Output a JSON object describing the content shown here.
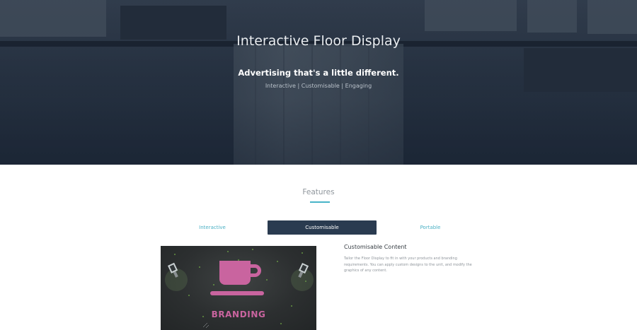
{
  "hero": {
    "title": "Interactive Floor Display",
    "subtitle": "Advertising that's a little different.",
    "tagline": "Interactive | Customisable | Engaging"
  },
  "features": {
    "heading": "Features",
    "tabs": [
      {
        "label": "Interactive",
        "active": false
      },
      {
        "label": "Customisable",
        "active": true
      },
      {
        "label": "Portable",
        "active": false
      }
    ],
    "content": {
      "title": "Customisable Content",
      "body": "Tailor the Floor Display to fit in with your products and branding requirements. You can apply custom designs to the unit, and modify the graphics of any content.",
      "image_text": "BRANDING",
      "image_icon": "coffee-cup-icon"
    }
  },
  "colors": {
    "accent": "#48b4c8",
    "tab_active_bg": "#2a3b50",
    "brand_pink": "#c9649f"
  }
}
